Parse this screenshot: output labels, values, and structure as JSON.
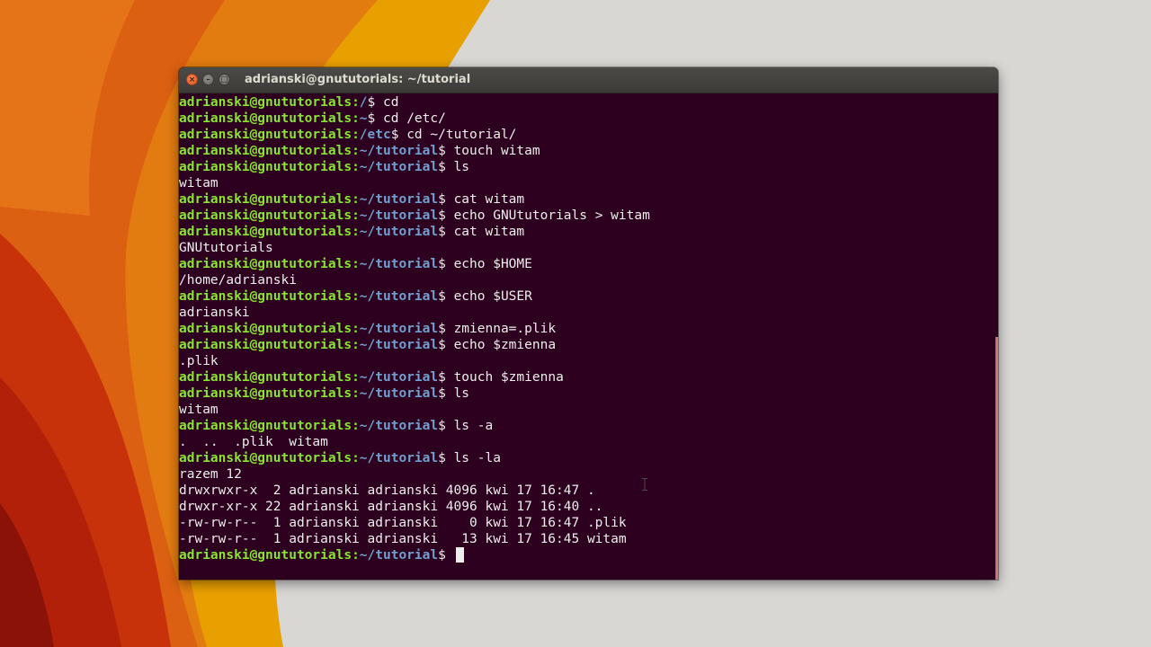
{
  "window": {
    "title": "adrianski@gnututorials: ~/tutorial",
    "buttons": {
      "close": "×",
      "minimize": "–",
      "maximize": "□"
    }
  },
  "colors": {
    "terminal_bg": "#2c001e",
    "prompt_user": "#8ae234",
    "prompt_path": "#729fcf",
    "text": "#eeeeec"
  },
  "terminal": {
    "lines": [
      {
        "type": "prompt",
        "user": "adrianski@gnututorials",
        "path": "/",
        "command": "cd"
      },
      {
        "type": "prompt",
        "user": "adrianski@gnututorials",
        "path": "~",
        "command": "cd /etc/"
      },
      {
        "type": "prompt",
        "user": "adrianski@gnututorials",
        "path": "/etc",
        "command": "cd ~/tutorial/"
      },
      {
        "type": "prompt",
        "user": "adrianski@gnututorials",
        "path": "~/tutorial",
        "command": "touch witam"
      },
      {
        "type": "prompt",
        "user": "adrianski@gnututorials",
        "path": "~/tutorial",
        "command": "ls"
      },
      {
        "type": "output",
        "text": "witam"
      },
      {
        "type": "prompt",
        "user": "adrianski@gnututorials",
        "path": "~/tutorial",
        "command": "cat witam"
      },
      {
        "type": "prompt",
        "user": "adrianski@gnututorials",
        "path": "~/tutorial",
        "command": "echo GNUtutorials > witam"
      },
      {
        "type": "prompt",
        "user": "adrianski@gnututorials",
        "path": "~/tutorial",
        "command": "cat witam"
      },
      {
        "type": "output",
        "text": "GNUtutorials"
      },
      {
        "type": "prompt",
        "user": "adrianski@gnututorials",
        "path": "~/tutorial",
        "command": "echo $HOME"
      },
      {
        "type": "output",
        "text": "/home/adrianski"
      },
      {
        "type": "prompt",
        "user": "adrianski@gnututorials",
        "path": "~/tutorial",
        "command": "echo $USER"
      },
      {
        "type": "output",
        "text": "adrianski"
      },
      {
        "type": "prompt",
        "user": "adrianski@gnututorials",
        "path": "~/tutorial",
        "command": "zmienna=.plik"
      },
      {
        "type": "prompt",
        "user": "adrianski@gnututorials",
        "path": "~/tutorial",
        "command": "echo $zmienna"
      },
      {
        "type": "output",
        "text": ".plik"
      },
      {
        "type": "prompt",
        "user": "adrianski@gnututorials",
        "path": "~/tutorial",
        "command": "touch $zmienna"
      },
      {
        "type": "prompt",
        "user": "adrianski@gnututorials",
        "path": "~/tutorial",
        "command": "ls"
      },
      {
        "type": "output",
        "text": "witam"
      },
      {
        "type": "prompt",
        "user": "adrianski@gnututorials",
        "path": "~/tutorial",
        "command": "ls -a"
      },
      {
        "type": "output",
        "text": ".  ..  .plik  witam"
      },
      {
        "type": "prompt",
        "user": "adrianski@gnututorials",
        "path": "~/tutorial",
        "command": "ls -la"
      },
      {
        "type": "output",
        "text": "razem 12"
      },
      {
        "type": "output",
        "text": "drwxrwxr-x  2 adrianski adrianski 4096 kwi 17 16:47 ."
      },
      {
        "type": "output",
        "text": "drwxr-xr-x 22 adrianski adrianski 4096 kwi 17 16:40 .."
      },
      {
        "type": "output",
        "text": "-rw-rw-r--  1 adrianski adrianski    0 kwi 17 16:47 .plik"
      },
      {
        "type": "output",
        "text": "-rw-rw-r--  1 adrianski adrianski   13 kwi 17 16:45 witam"
      },
      {
        "type": "prompt",
        "user": "adrianski@gnututorials",
        "path": "~/tutorial",
        "command": "",
        "cursor": true
      }
    ]
  }
}
